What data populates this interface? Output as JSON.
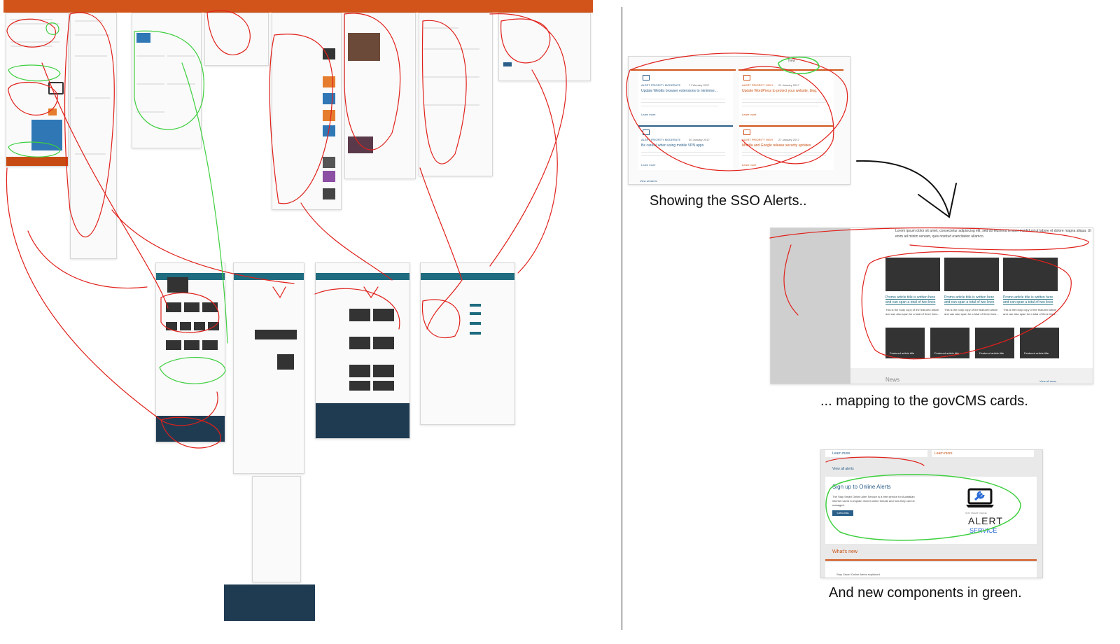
{
  "captions": {
    "sso_alerts": "Showing the SSO Alerts..",
    "govcms_cards": "... mapping to the govCMS cards.",
    "new_components": "And new components in green."
  },
  "sso_panel": {
    "view_all": "View all alerts",
    "news": "New",
    "alerts": [
      {
        "priority": "ALERT PRIORITY MODERATE",
        "date": "7 February 2017",
        "title": "Update WebEx browser extensions to minimise...",
        "more": "Learn more"
      },
      {
        "priority": "ALERT PRIORITY HIGH",
        "date": "21 January 2017",
        "title": "Update WordPress to protect your website, blog,",
        "more": "Learn more"
      },
      {
        "priority": "ALERT PRIORITY MODERATE",
        "date": "30 January 2017",
        "title": "Be careful when using mobile VPN apps",
        "more": "Learn more"
      },
      {
        "priority": "ALERT PRIORITY HIGH",
        "date": "27 January 2017",
        "title": "Mozilla and Google release security updates",
        "more": "Learn more"
      }
    ]
  },
  "govcms_panel": {
    "intro": "Lorem ipsum dolor sit amet, consectetur adipisicing elit, sed do eiusmod tempor incididunt ut labore et dolore magna aliqua. Ut enim ad minim veniam, quis nostrud exercitation ullamco.",
    "promo_title": "Promo article title is written here and can span a total of two lines",
    "promo_body": "This is the body copy of the featured article and can also span for a total of three lines...",
    "featured_title": "Featured article title",
    "news": "News",
    "view_all": "View all news"
  },
  "new_panel": {
    "learn_more_left": "Learn more",
    "learn_more_right": "Learn more",
    "view_all": "View all alerts",
    "signup_title": "Sign up to Online Alerts",
    "signup_body": "The Stay Smart Online Alert Service is a free service for Australian internet users to explain recent online threats and how they can be managed.",
    "subscribe": "SUBSCRIBE",
    "logo_small": "STAY SMART ONLINE",
    "logo_alert": "ALERT",
    "logo_service": "SERVICE",
    "whats_new": "What's new",
    "footer_link": "Stay Smart Online Alerts explained"
  },
  "colors": {
    "accent_orange": "#d2541b",
    "teal": "#1f6b7f",
    "navy": "#1f3b52",
    "red_annotation": "#e0201a",
    "green_annotation": "#3fcf3f"
  }
}
